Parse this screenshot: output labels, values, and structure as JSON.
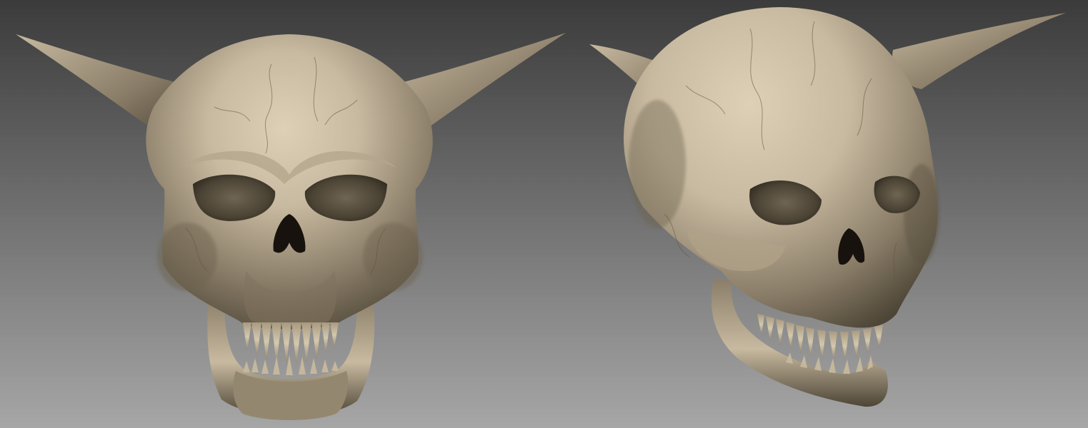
{
  "scene": {
    "background": {
      "top": "#3b3b3b",
      "bottom": "#a6a6a6"
    },
    "material": {
      "base": "#8a7d68",
      "light": "#c8baa0",
      "highlight": "#ddd0b6",
      "dark": "#4d4536",
      "socket": "#3a3429",
      "hole": "#17120d",
      "tooth": "#cfc2a6"
    },
    "models": [
      {
        "id": "front",
        "view": "front"
      },
      {
        "id": "three-quarter",
        "view": "three-quarter"
      }
    ]
  }
}
